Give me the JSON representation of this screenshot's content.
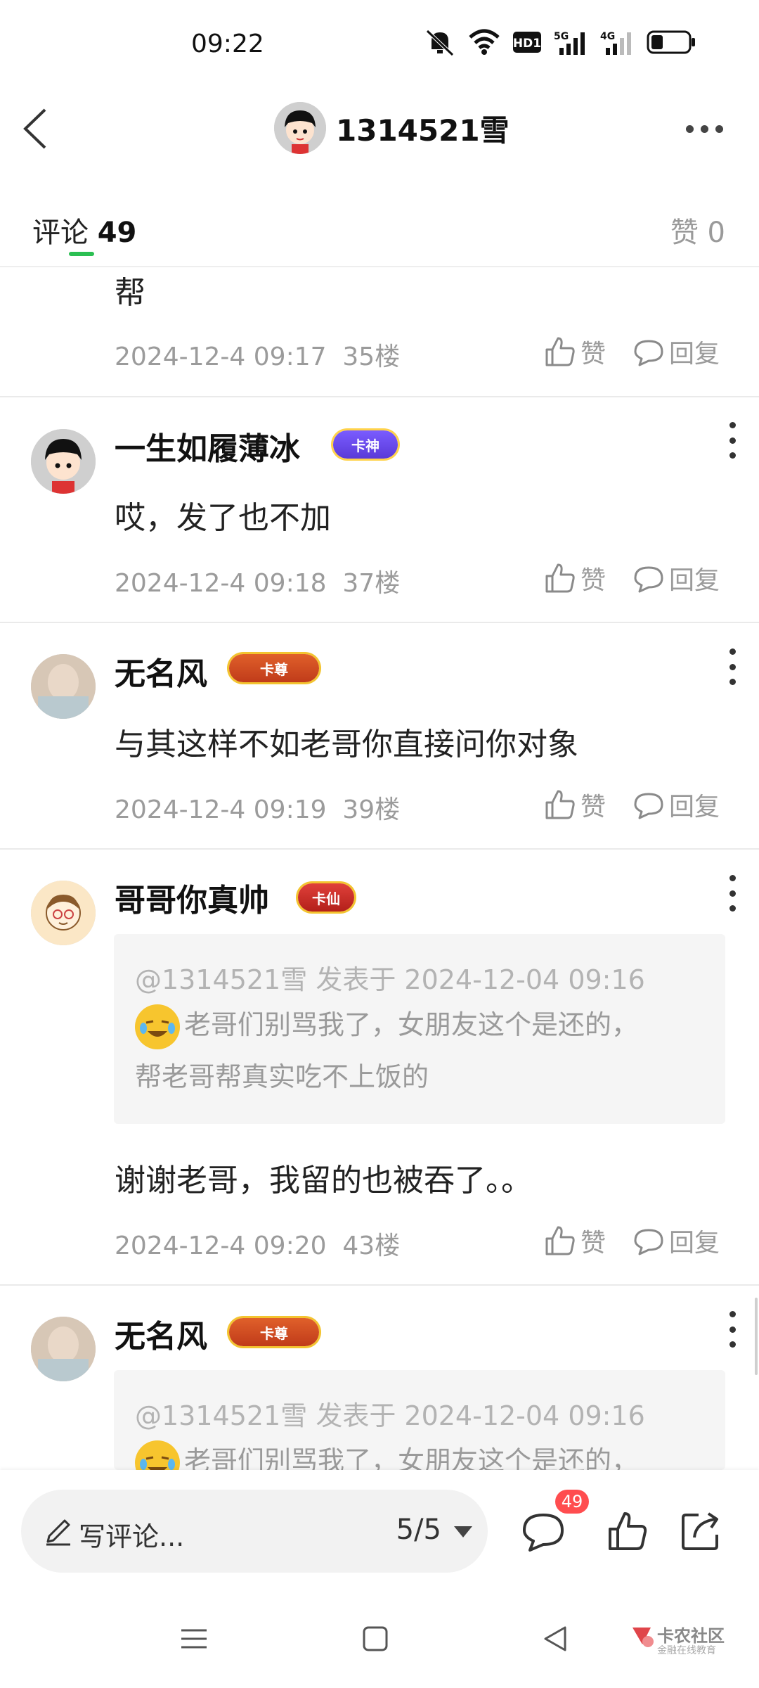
{
  "status_bar": {
    "time": "09:22",
    "hd_label": "HD1",
    "net1": "5G",
    "net2": "4G"
  },
  "header": {
    "title": "1314521雪"
  },
  "tabs": {
    "comments_label": "评论",
    "comments_count": "49",
    "likes_label": "赞 0"
  },
  "actions": {
    "like_label": "赞",
    "reply_label": "回复"
  },
  "comments": [
    {
      "text": "帮",
      "date": "2024-12-4 09:17",
      "floor": "35楼"
    },
    {
      "name": "一生如履薄冰",
      "badge": "卡神",
      "text": "哎，发了也不加",
      "date": "2024-12-4 09:18",
      "floor": "37楼"
    },
    {
      "name": "无名风",
      "badge": "卡尊",
      "text": "与其这样不如老哥你直接问你对象",
      "date": "2024-12-4 09:19",
      "floor": "39楼"
    },
    {
      "name": "哥哥你真帅",
      "badge": "卡仙",
      "quote_head": "@1314521雪 发表于 2024-12-04 09:16",
      "quote_line1": "老哥们别骂我了，女朋友这个是还的，",
      "quote_line2": "帮老哥帮真实吃不上饭的",
      "text": "谢谢老哥，我留的也被吞了。。",
      "date": "2024-12-4 09:20",
      "floor": "43楼"
    },
    {
      "name": "无名风",
      "badge": "卡尊",
      "quote_head": "@1314521雪 发表于 2024-12-04 09:16",
      "quote_line1": "老哥们别骂我了，女朋友这个是还的，"
    }
  ],
  "bottom_bar": {
    "compose_placeholder": "写评论...",
    "page_indicator": "5/5",
    "comment_badge": "49"
  },
  "watermark": {
    "main": "卡农社区",
    "sub": "金融在线教育"
  },
  "colors": {
    "accent_green": "#2bbf52",
    "badge_red": "#ff4d4f",
    "meta_gray": "#9b9b9b"
  }
}
